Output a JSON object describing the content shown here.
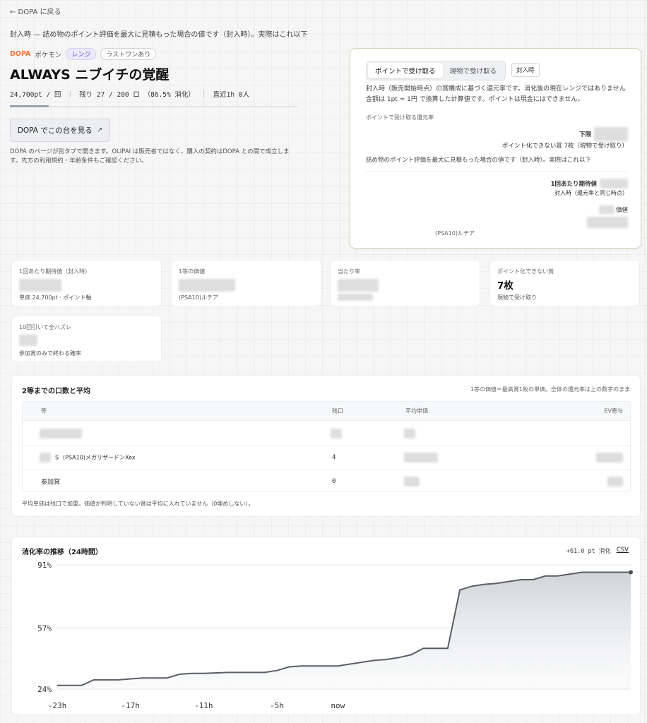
{
  "nav": {
    "back_label": "← DOPA に戻る"
  },
  "top_notice": "封入時 — 詰め物のポイント評価を最大に見積もった場合の値です（封入時）。実際はこれ以下",
  "tags": {
    "brand": "DOPA",
    "category": "ポケモン",
    "range": "レンジ",
    "last_one": "ラストワンあり"
  },
  "title": "ALWAYS ニブイチの覚醒",
  "stats": {
    "price": "24,700pt / 回",
    "remaining": "残り 27 / 200 口 （86.5% 消化）",
    "recent": "直近1h 0人"
  },
  "dopa_button": {
    "label": "DOPA でこの台を見る",
    "icon": "external-arrow-icon"
  },
  "dopa_note": "DOPA のページが別タブで開きます。OLIPAI は販売者ではなく、購入の契約はDOPA との間で成立します。先方の利用規約・年齢条件もご確認ください。",
  "panel": {
    "tab_points": "ポイントで受け取る",
    "tab_physical": "現物で受け取る",
    "pill": "封入時",
    "desc": "封入時（販売開始時点）の賞構成に基づく還元率です。消化後の現在レンジではありません",
    "desc2": "金額は 1pt = 1円 で換算した計算値です。ポイントは現金にはできません。",
    "rate_label": "ポイントで受け取る還元率",
    "lower_label": "下限",
    "unconvertible": "ポイント化できない賞 7枚（現物で受け取り）",
    "note": "詰め物のポイント評価を最大に見積もった場合の値です（封入時）。実際はこれ以下",
    "ev_label": "1回あたり期待値",
    "ev_sub": "封入時（還元率と同じ時点）",
    "value_label": "価値",
    "prize_name": "(PSA10)ルチア"
  },
  "cards": [
    {
      "label": "1回あたり期待値（封入時）",
      "sub": "単価 24,700pt · ポイント軸"
    },
    {
      "label": "1等の価値",
      "sub": "(PSA10)ルチア"
    },
    {
      "label": "当たり率",
      "sub": ""
    },
    {
      "label": "ポイント化できない賞",
      "value": "7枚",
      "sub": "現物で受け取り"
    },
    {
      "label": "10回引いて全ハズレ",
      "sub": "参加賞のみで終わる確率"
    }
  ],
  "table": {
    "title": "2等までの口数と平均",
    "note": "1等の価値＝最高賞1枚の単価。全体の還元率は上の数字のまま",
    "headers": [
      "等",
      "残口",
      "平均単価",
      "EV寄与"
    ],
    "rows": [
      {
        "grade": "",
        "name": "",
        "remaining": "",
        "avg": "",
        "ev": ""
      },
      {
        "grade": "S",
        "name": "(PSA10)メガリザードンXex",
        "remaining": "4",
        "avg": "",
        "ev": ""
      },
      {
        "grade": "参加賞",
        "name": "",
        "remaining": "0",
        "avg": "",
        "ev": ""
      }
    ],
    "footnote": "平均単価は残口で加重。価値が判明していない賞は平均に入れていません（0埋めしない）。"
  },
  "chart": {
    "title": "消化率の推移（24時間）",
    "delta": "+61.0 pt 消化",
    "csv": "CSV"
  },
  "chart_data": {
    "type": "area",
    "title": "消化率の推移（24時間）",
    "xlabel": "",
    "ylabel": "",
    "ylim": [
      24,
      91
    ],
    "y_ticks": [
      "91%",
      "57%",
      "24%"
    ],
    "y_tick_values": [
      91,
      57,
      24
    ],
    "x_ticks": [
      "-23h",
      "-17h",
      "-11h",
      "-5h",
      "now"
    ],
    "x_tick_values": [
      -23,
      -17,
      -11,
      -5,
      0
    ],
    "x_domain": [
      -23,
      24
    ],
    "grid": true,
    "x": [
      -23,
      -21,
      -20,
      -18,
      -16,
      -14,
      -13,
      -12,
      -11,
      -9,
      -8,
      -7,
      -6,
      -5,
      -4,
      -3,
      -2,
      0,
      1,
      2,
      3,
      4,
      5,
      6,
      7,
      8,
      9,
      10,
      11,
      12,
      13,
      14,
      15,
      16,
      17,
      18,
      19,
      20,
      21,
      22,
      23,
      24
    ],
    "values": [
      26.0,
      26.0,
      29.0,
      29.0,
      30.0,
      30.0,
      32.0,
      32.5,
      32.5,
      33.0,
      33.0,
      33.0,
      33.0,
      34.0,
      36.0,
      36.5,
      36.5,
      36.5,
      37.5,
      38.5,
      39.5,
      40.0,
      41.0,
      42.5,
      46.0,
      46.0,
      46.0,
      77.5,
      79.5,
      80.5,
      81.0,
      82.0,
      83.0,
      83.0,
      85.0,
      85.0,
      86.0,
      87.0,
      87.0,
      87.0,
      87.0,
      87.0
    ]
  }
}
